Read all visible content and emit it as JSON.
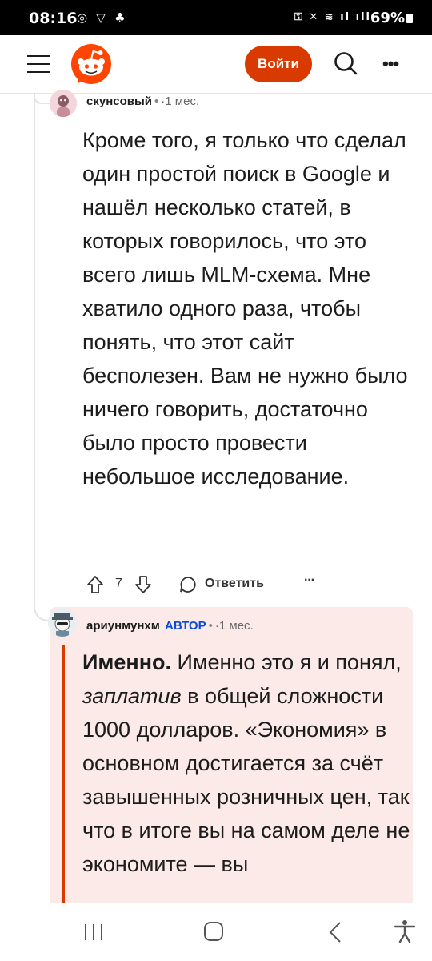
{
  "status_bar": {
    "time": "08:16",
    "left_icons": "◎ ▽ ♣",
    "right_icons": "⚿ ✕ ≋ ıl ıll",
    "battery": "69%"
  },
  "header": {
    "login_label": "Войти",
    "accent": "#d93a00"
  },
  "comment1": {
    "username": "скунсовый",
    "time": "1 мес.",
    "body": "Кроме того, я только что сделал один простой поиск в Google и нашёл несколько статей, в которых говорилось, что это всего лишь MLM-схема. Мне хватило одного раза, чтобы понять, что этот сайт бесполезен. Вам не нужно было ничего говорить, достаточно было просто провести небольшое исследование.",
    "votes": "7",
    "reply_label": "Ответить"
  },
  "comment2": {
    "username": "ариунмунхм",
    "op_badge": "АВТОР",
    "time": "1 мес.",
    "body_bold": "Именно.",
    "body_part1": " Именно это я и понял, ",
    "body_italic": "заплатив",
    "body_part2": " в общей сложности 1000 долларов. «Экономия» в основном достигается за счёт завышенных розничных цен, так что в итоге вы на самом деле не экономите — вы",
    "highlight_bg": "#fbeae7"
  }
}
